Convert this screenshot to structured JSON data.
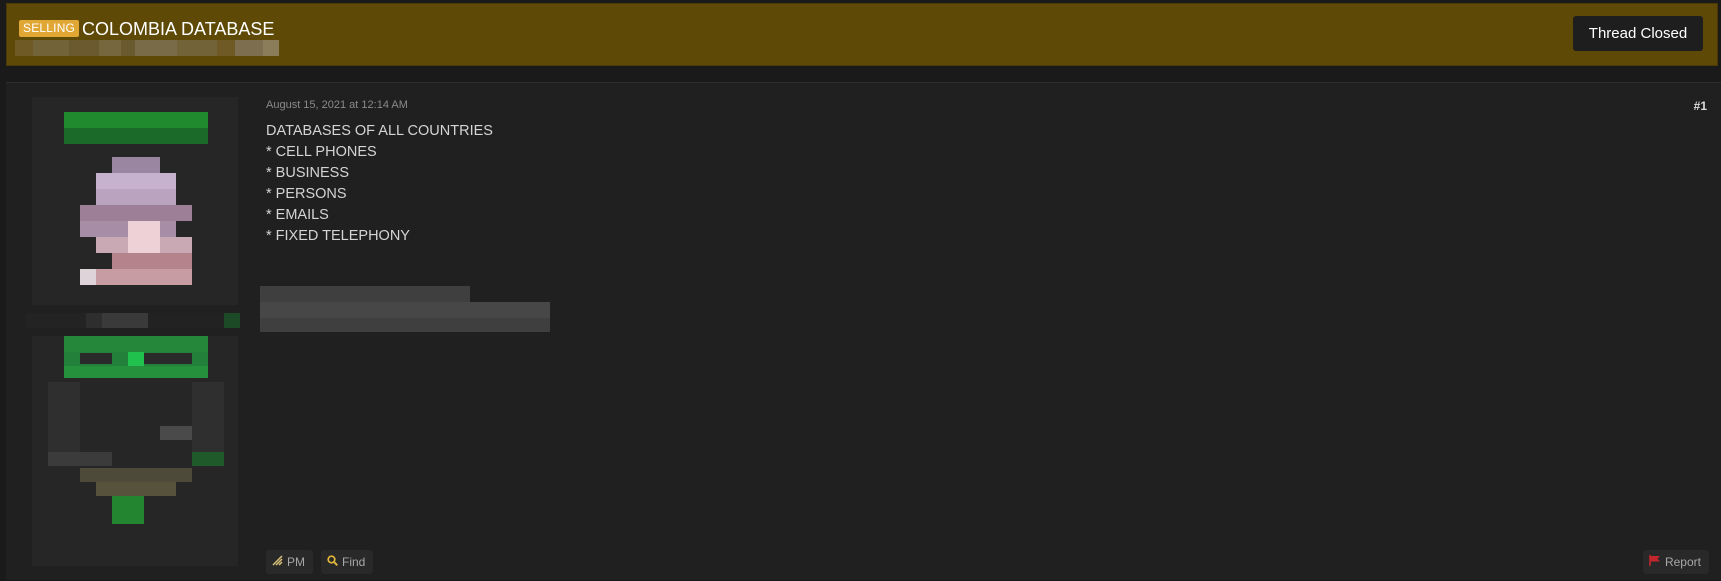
{
  "header": {
    "prefix": "SELLING",
    "title": "COLOMBIA DATABASE",
    "closed_label": "Thread Closed"
  },
  "post": {
    "date": "August 15, 2021 at 12:14 AM",
    "number": "#1",
    "lines": [
      "DATABASES OF ALL COUNTRIES",
      "",
      "* CELL PHONES",
      "* BUSINESS",
      "* PERSONS",
      "* EMAILS",
      "* FIXED TELEPHONY"
    ]
  },
  "actions": {
    "pm": "PM",
    "find": "Find",
    "report": "Report"
  },
  "icons": {
    "pm": "pm-icon",
    "find": "search-icon",
    "report": "flag-icon"
  },
  "colors": {
    "header_bg": "#5e4906",
    "prefix_bg": "#e0a735",
    "page_bg": "#1a1a1a",
    "post_bg": "#202020",
    "report_flag": "#c0262c",
    "find_icon": "#e2b93b"
  }
}
